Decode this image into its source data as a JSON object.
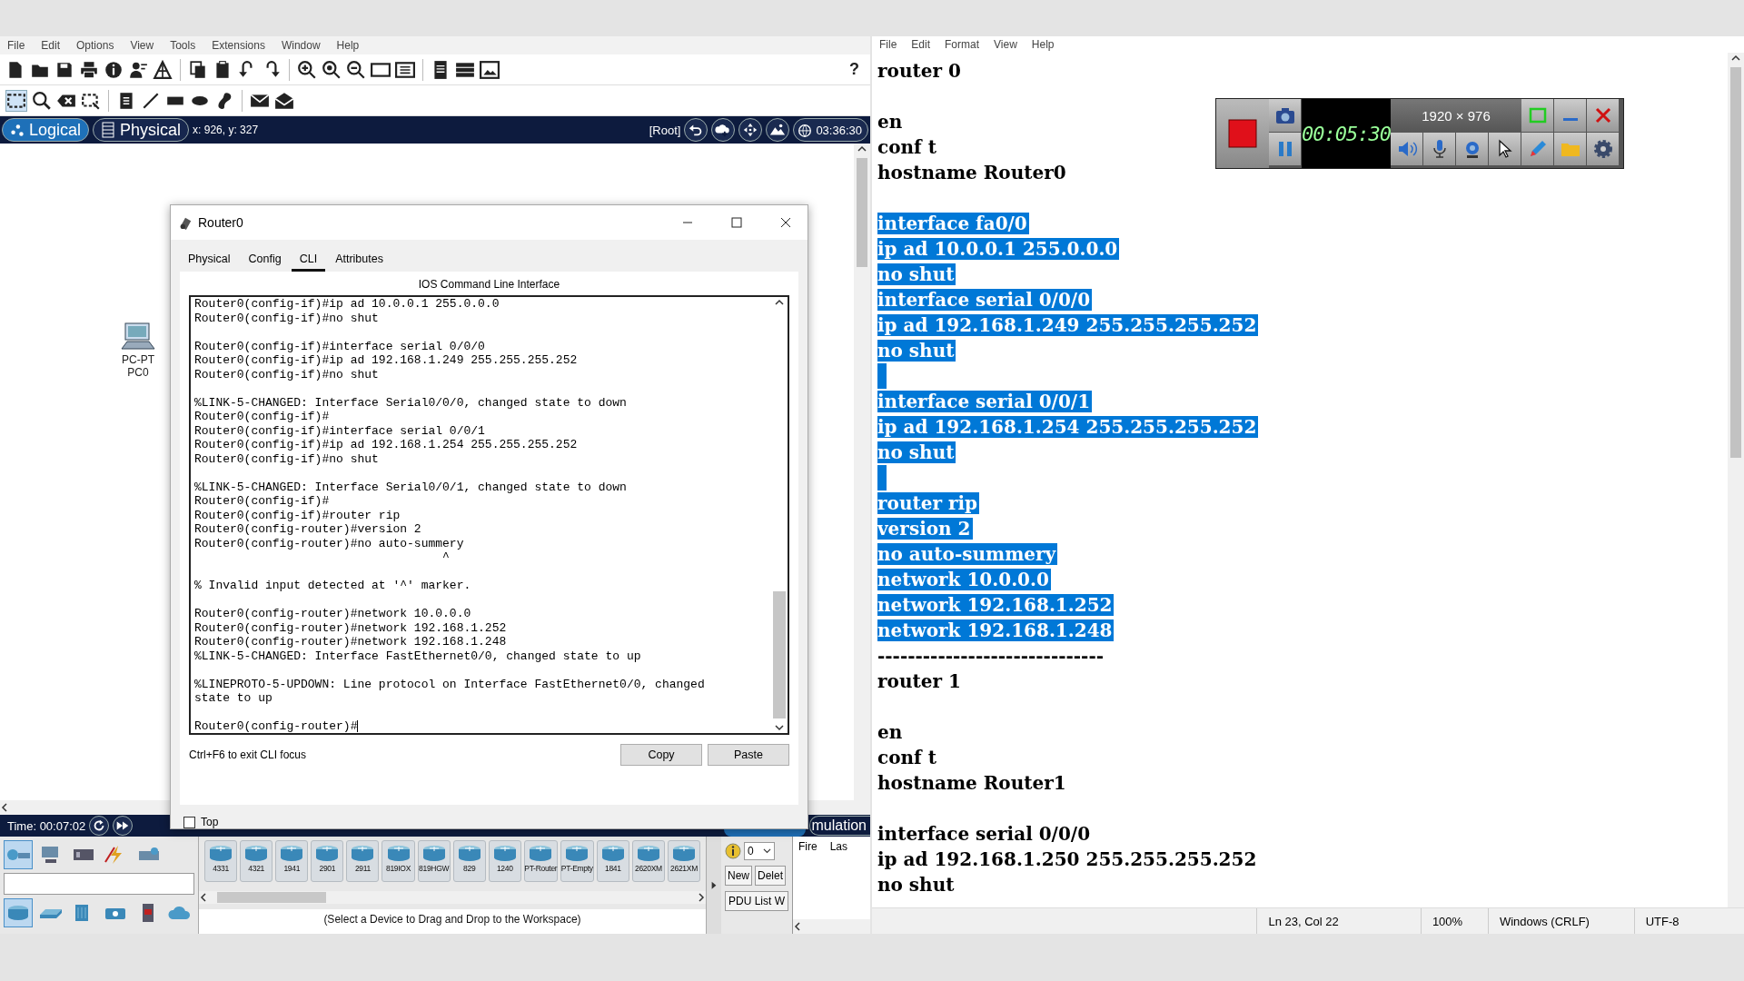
{
  "packet_tracer": {
    "menu": [
      "File",
      "Edit",
      "Options",
      "View",
      "Tools",
      "Extensions",
      "Window",
      "Help"
    ],
    "help_button": "?",
    "view_tabs": [
      {
        "label": "Logical",
        "selected": true
      },
      {
        "label": "Physical",
        "selected": false
      }
    ],
    "coordinates": "x: 926, y: 327",
    "root_label": "[Root]",
    "clock": "03:36:30",
    "workspace_devices": [
      {
        "model": "PC-PT",
        "name": "PC0"
      }
    ],
    "time": "Time: 00:07:02",
    "mode_label": "mulation",
    "category_top": [
      {
        "selected": true
      },
      {
        "selected": false
      },
      {
        "selected": false
      },
      {
        "selected": false
      },
      {
        "selected": false
      }
    ],
    "category_bottom": [
      {
        "selected": true
      },
      {
        "selected": false
      },
      {
        "selected": false
      },
      {
        "selected": false
      },
      {
        "selected": false
      },
      {
        "selected": false
      }
    ],
    "device_models": [
      "4331",
      "4321",
      "1941",
      "2901",
      "2911",
      "819IOX",
      "819HGW",
      "829",
      "1240",
      "PT-Router",
      "PT-Empty",
      "1841",
      "2620XM",
      "2621XM"
    ],
    "device_hint": "(Select a Device to Drag and Drop to the Workspace)",
    "scenario_value": "0",
    "pdu_buttons": [
      "New",
      "Delet",
      "PDU List W"
    ],
    "event_columns": [
      "Fire",
      "Las"
    ]
  },
  "router_dialog": {
    "title": "Router0",
    "tabs": [
      {
        "label": "Physical",
        "selected": false
      },
      {
        "label": "Config",
        "selected": false
      },
      {
        "label": "CLI",
        "selected": true
      },
      {
        "label": "Attributes",
        "selected": false
      }
    ],
    "heading": "IOS Command Line Interface",
    "console_blocks": [
      [
        "Router0(config-if)#ip ad 10.0.0.1 255.0.0.0",
        "Router0(config-if)#no shut"
      ],
      [
        "Router0(config-if)#interface serial 0/0/0",
        "Router0(config-if)#ip ad 192.168.1.249 255.255.255.252",
        "Router0(config-if)#no shut"
      ],
      [
        "%LINK-5-CHANGED: Interface Serial0/0/0, changed state to down",
        "Router0(config-if)#",
        "Router0(config-if)#interface serial 0/0/1",
        "Router0(config-if)#ip ad 192.168.1.254 255.255.255.252",
        "Router0(config-if)#no shut"
      ],
      [
        "%LINK-5-CHANGED: Interface Serial0/0/1, changed state to down",
        "Router0(config-if)#",
        "Router0(config-if)#router rip",
        "Router0(config-router)#version 2",
        "Router0(config-router)#no auto-summery",
        "                                   ^"
      ],
      [
        "% Invalid input detected at '^' marker."
      ],
      [
        "Router0(config-router)#network 10.0.0.0",
        "Router0(config-router)#network 192.168.1.252",
        "Router0(config-router)#network 192.168.1.248",
        "%LINK-5-CHANGED: Interface FastEthernet0/0, changed state to up"
      ],
      [
        "%LINEPROTO-5-UPDOWN: Line protocol on Interface FastEthernet0/0, changed",
        "state to up"
      ],
      [
        "Router0(config-router)#"
      ]
    ],
    "hint": "Ctrl+F6 to exit CLI focus",
    "buttons": [
      "Copy",
      "Paste"
    ],
    "top_checkbox": {
      "label": "Top",
      "checked": false
    }
  },
  "notepad": {
    "menu": [
      "File",
      "Edit",
      "Format",
      "View",
      "Help"
    ],
    "lines": [
      {
        "kind": "text",
        "text": "router 0",
        "selected": false
      },
      {
        "kind": "blank",
        "selected": false
      },
      {
        "kind": "text",
        "text": "en",
        "selected": false
      },
      {
        "kind": "text",
        "text": "conf t",
        "selected": false
      },
      {
        "kind": "text",
        "text": "hostname Router0",
        "selected": false
      },
      {
        "kind": "blank",
        "selected": false
      },
      {
        "kind": "text",
        "text": "interface fa0/0",
        "selected": true
      },
      {
        "kind": "text",
        "text": "ip ad 10.0.0.1 255.0.0.0",
        "selected": true
      },
      {
        "kind": "text",
        "text": "no shut",
        "selected": true
      },
      {
        "kind": "text",
        "text": "interface serial 0/0/0",
        "selected": true
      },
      {
        "kind": "text",
        "text": "ip ad 192.168.1.249 255.255.255.252",
        "selected": true
      },
      {
        "kind": "text",
        "text": "no shut",
        "selected": true
      },
      {
        "kind": "blank",
        "selected": true
      },
      {
        "kind": "text",
        "text": "interface serial 0/0/1",
        "selected": true
      },
      {
        "kind": "text",
        "text": "ip ad 192.168.1.254 255.255.255.252",
        "selected": true
      },
      {
        "kind": "text",
        "text": "no shut",
        "selected": true
      },
      {
        "kind": "blank",
        "selected": true
      },
      {
        "kind": "text",
        "text": "router rip",
        "selected": true
      },
      {
        "kind": "text",
        "text": "version 2",
        "selected": true
      },
      {
        "kind": "text",
        "text": "no auto-summery",
        "selected": true
      },
      {
        "kind": "text",
        "text": "network 10.0.0.0",
        "selected": true
      },
      {
        "kind": "text",
        "text": "network 192.168.1.252",
        "selected": true
      },
      {
        "kind": "text",
        "text": "network 192.168.1.248",
        "selected": true
      },
      {
        "kind": "text",
        "text": "------------------------------",
        "selected": false
      },
      {
        "kind": "text",
        "text": "router 1",
        "selected": false
      },
      {
        "kind": "blank",
        "selected": false
      },
      {
        "kind": "text",
        "text": "en",
        "selected": false
      },
      {
        "kind": "text",
        "text": "conf t",
        "selected": false
      },
      {
        "kind": "text",
        "text": "hostname Router1",
        "selected": false
      },
      {
        "kind": "blank",
        "selected": false
      },
      {
        "kind": "text",
        "text": "interface serial 0/0/0",
        "selected": false
      },
      {
        "kind": "text",
        "text": "ip ad 192.168.1.250 255.255.255.252",
        "selected": false
      },
      {
        "kind": "text",
        "text": "no shut",
        "selected": false
      }
    ],
    "status": [
      "Ln 23, Col 22",
      "100%",
      "Windows (CRLF)",
      "UTF-8"
    ]
  },
  "recorder": {
    "timer": "00:05:30",
    "resolution": "1920 × 976"
  }
}
